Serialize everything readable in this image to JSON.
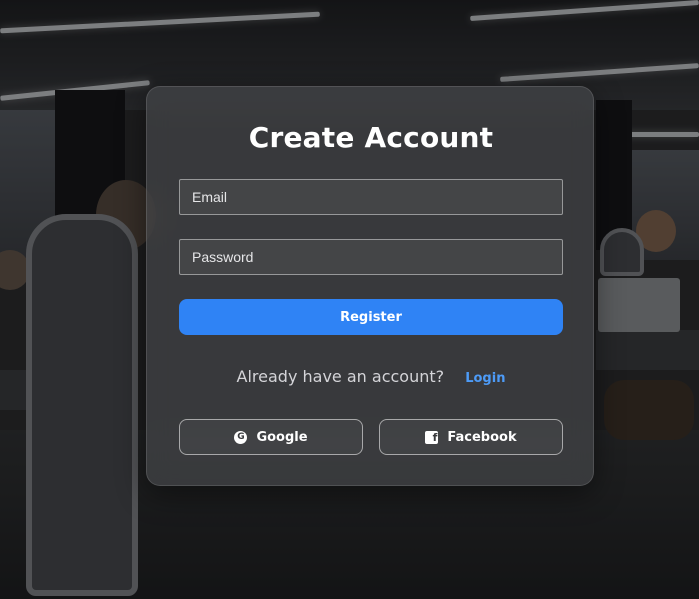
{
  "form": {
    "title": "Create Account",
    "email_placeholder": "Email",
    "password_placeholder": "Password",
    "register_label": "Register"
  },
  "login_prompt": {
    "text": "Already have an account?",
    "link_label": "Login"
  },
  "social": {
    "google_label": "Google",
    "google_icon": "google-icon",
    "facebook_label": "Facebook",
    "facebook_icon": "facebook-icon"
  },
  "colors": {
    "accent": "#2f83f5",
    "link": "#4d9bf7"
  }
}
